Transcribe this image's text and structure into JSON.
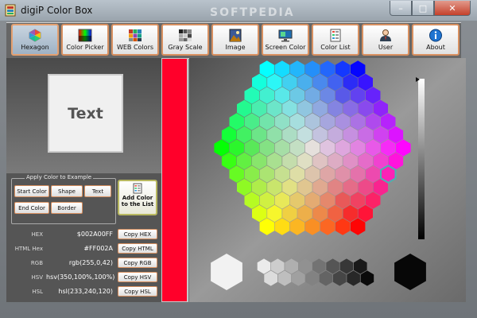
{
  "window": {
    "title": "digiP Color Box",
    "watermark": "SOFTPEDIA",
    "controls": {
      "minimize": "–",
      "maximize": "□",
      "close": "✕"
    }
  },
  "toolbar": {
    "buttons": [
      {
        "label": "Hexagon",
        "icon": "hexagon-icon",
        "active": true
      },
      {
        "label": "Color Picker",
        "icon": "color-picker-icon",
        "active": false
      },
      {
        "label": "WEB Colors",
        "icon": "web-colors-icon",
        "active": false
      },
      {
        "label": "Gray Scale",
        "icon": "gray-scale-icon",
        "active": false
      },
      {
        "label": "Image",
        "icon": "image-icon",
        "active": false
      },
      {
        "label": "Screen Color",
        "icon": "screen-color-icon",
        "active": false
      },
      {
        "label": "Color List",
        "icon": "color-list-icon",
        "active": false
      },
      {
        "label": "User",
        "icon": "user-icon",
        "active": false
      },
      {
        "label": "About",
        "icon": "about-icon",
        "active": false
      }
    ]
  },
  "preview": {
    "text": "Text"
  },
  "apply": {
    "group_label": "Apply Color to Example",
    "start_color": "Start Color",
    "shape": "Shape",
    "text": "Text",
    "end_color": "End Color",
    "border": "Border"
  },
  "add_color": {
    "label": "Add Color to the List"
  },
  "values": [
    {
      "key": "HEX",
      "value": "$002A00FF",
      "button": "Copy HEX"
    },
    {
      "key": "HTML Hex",
      "value": "#FF002A",
      "button": "Copy HTML"
    },
    {
      "key": "RGB",
      "value": "rgb(255,0,42)",
      "button": "Copy RGB"
    },
    {
      "key": "HSV",
      "value": "hsv(350,100%,100%)",
      "button": "Copy HSV"
    },
    {
      "key": "HSL",
      "value": "hsl(233,240,120)",
      "button": "Copy HSL"
    }
  ],
  "colors": {
    "selected": "#ff002a",
    "accent_border": "#d89060",
    "selected_cell_outline": "#49b4b0"
  }
}
